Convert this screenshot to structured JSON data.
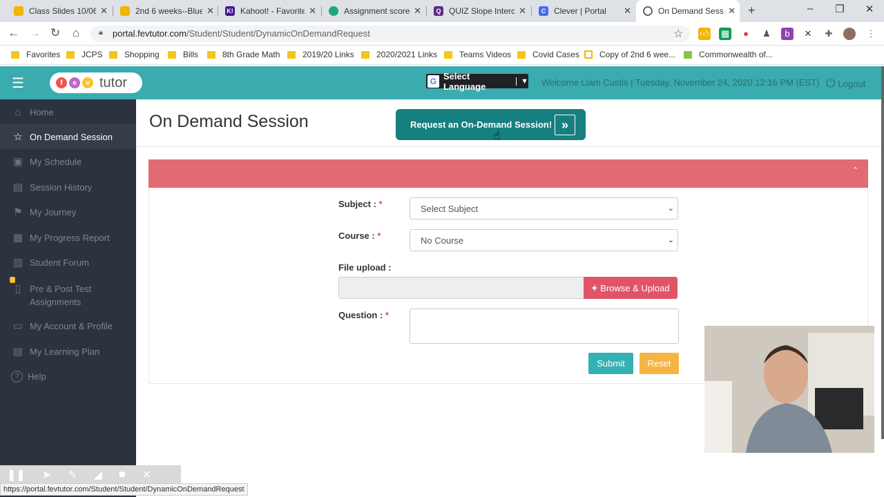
{
  "browser": {
    "tabs": [
      {
        "title": "Class Slides 10/06",
        "color": "#f4b400",
        "glyph": ""
      },
      {
        "title": "2nd 6 weeks--Blue",
        "color": "#f4b400",
        "glyph": ""
      },
      {
        "title": "Kahoot! - Favorites",
        "color": "#46178f",
        "glyph": "K!"
      },
      {
        "title": "Assignment score",
        "color": "#1fa67a",
        "glyph": ""
      },
      {
        "title": "QUIZ Slope Interc",
        "color": "#5b2a86",
        "glyph": "Q"
      },
      {
        "title": "Clever | Portal",
        "color": "#436cf2",
        "glyph": "C"
      },
      {
        "title": "On Demand Sessio",
        "color": "#888888",
        "glyph": ""
      }
    ],
    "new_tab": "+",
    "url_prefix": "portal.fevtutor.com",
    "url_path": "/Student/Student/DynamicOnDemandRequest",
    "status_url": "https://portal.fevtutor.com/Student/Student/DynamicOnDemandRequest",
    "bookmarks": [
      "Favorites",
      "JCPS",
      "Shopping",
      "Bills",
      "8th Grade Math",
      "2019/20 Links",
      "2020/2021 Links",
      "Teams Videos",
      "Covid Cases",
      "Copy of 2nd 6 wee...",
      "Commonwealth of..."
    ]
  },
  "header": {
    "logo_letters": [
      "f",
      "e",
      "v"
    ],
    "logo_text": "tutor",
    "select_language": "Select Language",
    "welcome": "Welcome Liam Custis | Tuesday, November 24, 2020 12:16 PM (EST)",
    "logout": "Logout",
    "accent": "#3aabaf"
  },
  "sidebar": {
    "items": [
      {
        "label": "Home",
        "icon": "home-icon",
        "glyph": "⌂"
      },
      {
        "label": "On Demand Session",
        "icon": "star-icon",
        "glyph": "☆"
      },
      {
        "label": "My Schedule",
        "icon": "calendar-icon",
        "glyph": "▣"
      },
      {
        "label": "Session History",
        "icon": "history-icon",
        "glyph": "▤"
      },
      {
        "label": "My Journey",
        "icon": "signpost-icon",
        "glyph": "⚑"
      },
      {
        "label": "My Progress Report",
        "icon": "report-icon",
        "glyph": "▦"
      },
      {
        "label": "Student Forum",
        "icon": "forum-icon",
        "glyph": "▥"
      },
      {
        "label": "Pre & Post Test",
        "label2": "Assignments",
        "icon": "test-icon",
        "glyph": "▯",
        "badge": "0"
      },
      {
        "label": "My Account & Profile",
        "icon": "account-icon",
        "glyph": "▭"
      },
      {
        "label": "My Learning Plan",
        "icon": "plan-icon",
        "glyph": "▤"
      },
      {
        "label": "Help",
        "icon": "help-icon",
        "glyph": "?"
      }
    ]
  },
  "main": {
    "title": "On Demand Session",
    "request_button": "Request an On-Demand Session!",
    "form": {
      "subject_label": "Subject :",
      "subject_value": "Select Subject",
      "course_label": "Course :",
      "course_value": "No Course",
      "file_label": "File upload :",
      "browse_button": "Browse & Upload",
      "question_label": "Question :",
      "required_mark": "*",
      "submit": "Submit",
      "reset": "Reset"
    },
    "panel_color": "#e26a74"
  }
}
